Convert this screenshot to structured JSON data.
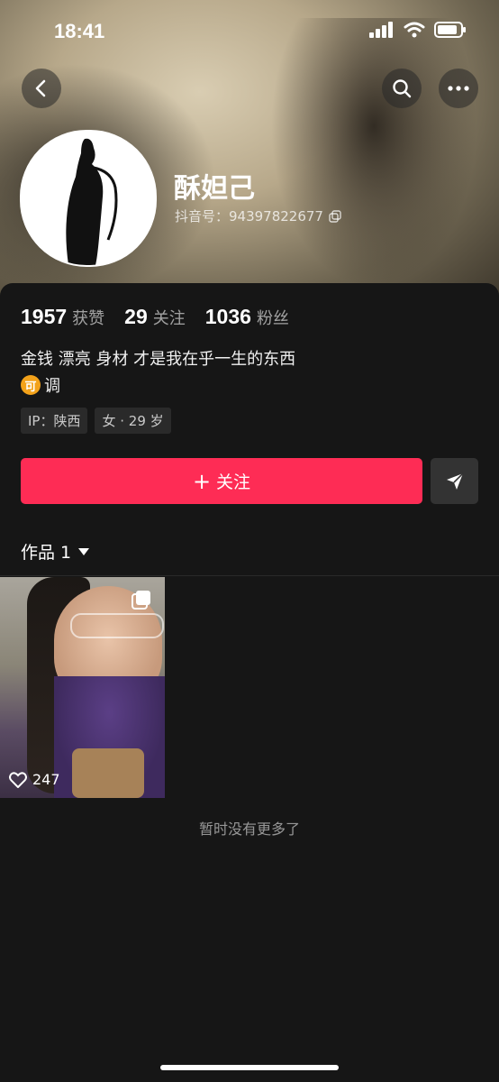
{
  "status_bar": {
    "time": "18:41"
  },
  "profile": {
    "name": "酥妲己",
    "douyin_id": "抖音号：94397822677"
  },
  "stats": [
    {
      "value": "1957",
      "label": "获赞"
    },
    {
      "value": "29",
      "label": "关注"
    },
    {
      "value": "1036",
      "label": "粉丝"
    }
  ],
  "bio": {
    "line1": "金钱 漂亮 身材 才是我在乎一生的东西",
    "badge": "可",
    "line2": "调"
  },
  "tags": [
    "IP：陕西",
    "女 · 29 岁"
  ],
  "actions": {
    "follow_label": "关注",
    "follow_plus": "+"
  },
  "tabs": {
    "works_label": "作品 1"
  },
  "video": {
    "likes": "247"
  },
  "footer": {
    "no_more": "暂时没有更多了"
  },
  "colors": {
    "accent": "#fe2c55",
    "background": "#161616"
  }
}
